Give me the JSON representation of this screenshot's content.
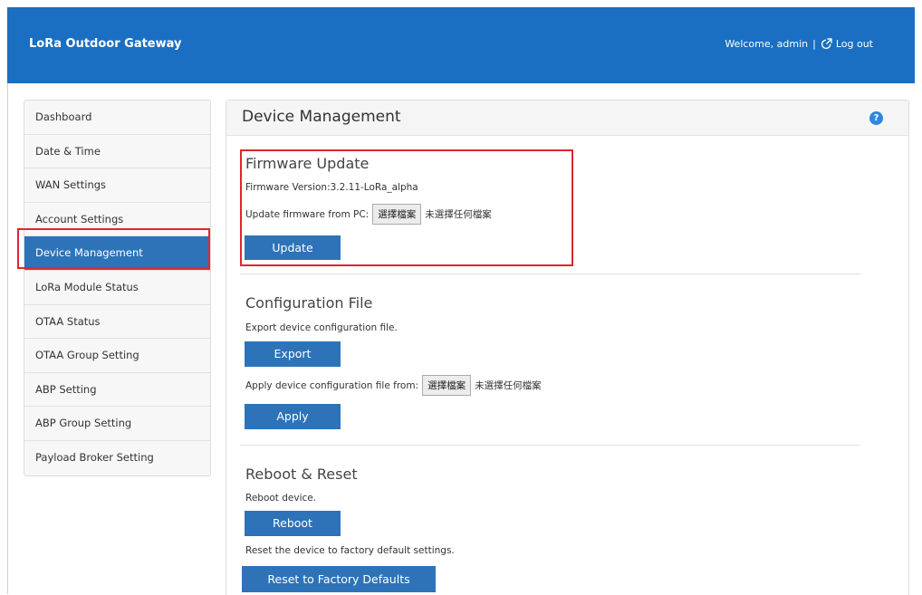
{
  "header": {
    "brand": "LoRa Outdoor Gateway",
    "welcome": "Welcome, admin",
    "separator": "|",
    "logout": "Log out"
  },
  "sidebar": {
    "items": [
      {
        "label": "Dashboard"
      },
      {
        "label": "Date & Time"
      },
      {
        "label": "WAN Settings"
      },
      {
        "label": "Account Settings"
      },
      {
        "label": "Device Management",
        "active": true
      },
      {
        "label": "LoRa Module Status"
      },
      {
        "label": "OTAA Status"
      },
      {
        "label": "OTAA Group Setting"
      },
      {
        "label": "ABP Setting"
      },
      {
        "label": "ABP Group Setting"
      },
      {
        "label": "Payload Broker Setting"
      }
    ]
  },
  "panel": {
    "title": "Device Management",
    "help": "?"
  },
  "firmware": {
    "title": "Firmware Update",
    "version_text": "Firmware Version:3.2.11-LoRa_alpha",
    "upload_label": "Update firmware from PC:",
    "choose_file": "選擇檔案",
    "no_file": "未選擇任何檔案",
    "update_button": "Update"
  },
  "config": {
    "title": "Configuration File",
    "export_text": "Export device configuration file.",
    "export_button": "Export",
    "apply_label": "Apply device configuration file from:",
    "choose_file": "選擇檔案",
    "no_file": "未選擇任何檔案",
    "apply_button": "Apply"
  },
  "reboot": {
    "title": "Reboot & Reset",
    "reboot_text": "Reboot device.",
    "reboot_button": "Reboot",
    "reset_text": "Reset the device to factory default settings.",
    "reset_button": "Reset to Factory Defaults"
  },
  "colors": {
    "header": "#1a6fc2",
    "button": "#2e73b8",
    "highlight": "#e0262d"
  }
}
